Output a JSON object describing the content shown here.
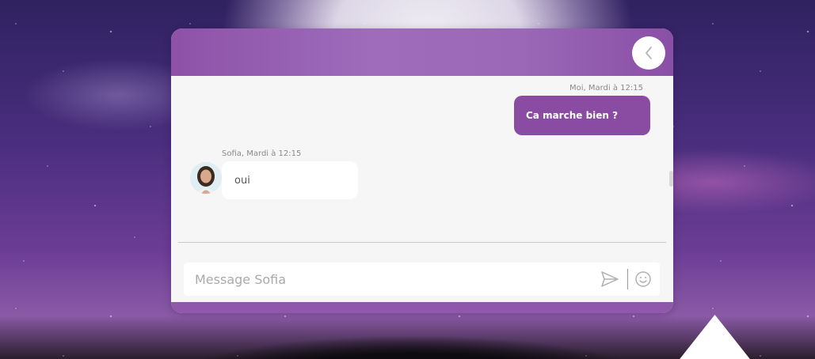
{
  "colors": {
    "header": "#9a68b6",
    "outgoing_bubble": "#8a4ba3",
    "incoming_bubble": "#ffffff",
    "window_bg": "#f6f6f6"
  },
  "header": {
    "back_icon": "chevron-left-icon"
  },
  "messages": [
    {
      "direction": "outgoing",
      "meta": "Moi, Mardi à 12:15",
      "text": "Ca marche bien ?"
    },
    {
      "direction": "incoming",
      "meta": "Sofia, Mardi à 12:15",
      "text": "oui",
      "avatar": "avatar-sofia"
    }
  ],
  "composer": {
    "placeholder": "Message Sofia",
    "value": "",
    "send_icon": "send-icon",
    "emoji_icon": "smiley-icon"
  }
}
